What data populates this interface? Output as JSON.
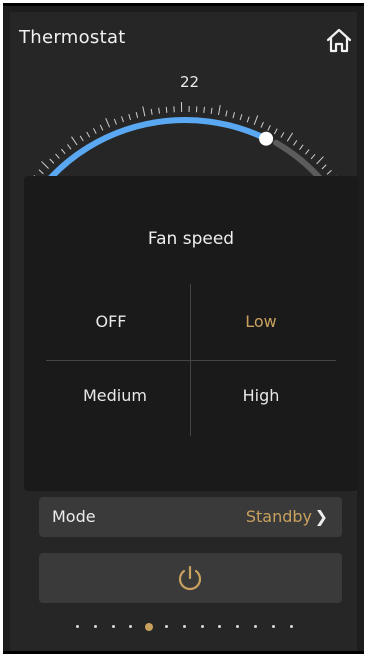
{
  "header": {
    "title": "Thermostat",
    "home_icon": "home-icon"
  },
  "dial": {
    "setpoint": "22",
    "arc_color": "#5aa8f2"
  },
  "fan_dialog": {
    "title": "Fan speed",
    "options": [
      "OFF",
      "Low",
      "Medium",
      "High"
    ],
    "selected": "Low"
  },
  "mode": {
    "label": "Mode",
    "value": "Standby"
  },
  "power": {
    "icon": "power-icon"
  },
  "pager": {
    "count": 13,
    "active_index": 4
  },
  "colors": {
    "accent": "#c9a15f",
    "panel": "#3a3a3a"
  }
}
